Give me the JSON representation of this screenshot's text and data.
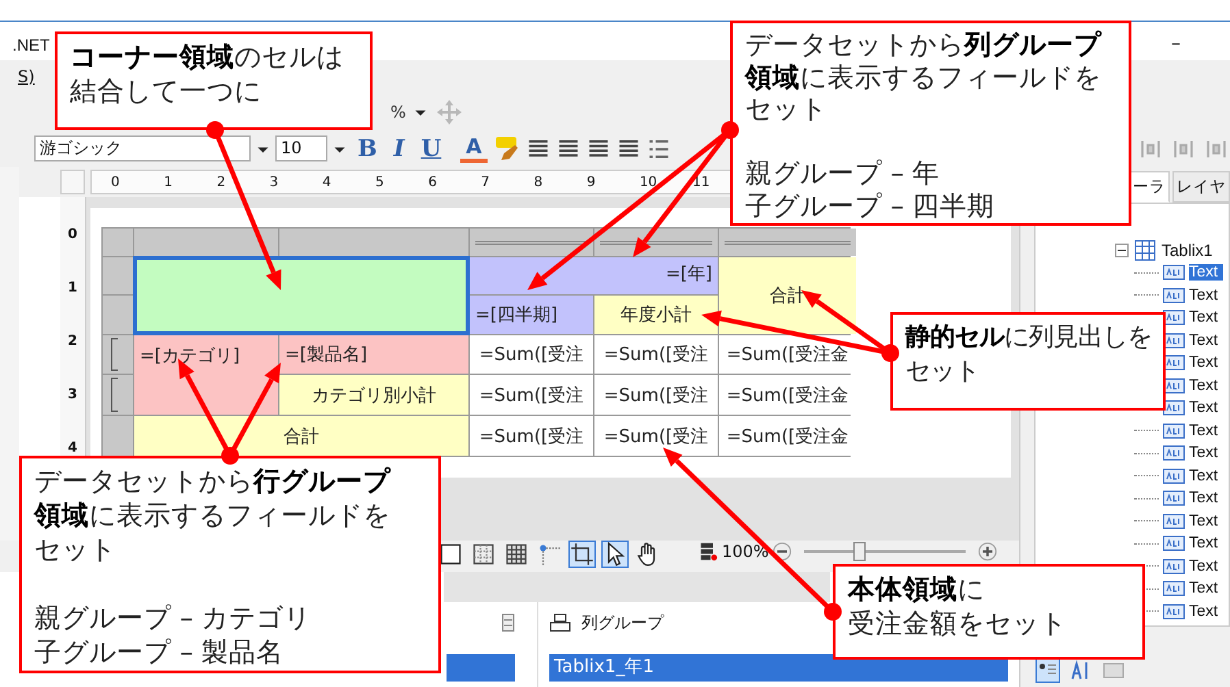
{
  "window": {
    "title": ".NET",
    "minimize": "–"
  },
  "menu": [
    "S)"
  ],
  "toolbar": {
    "zoom_value": "%",
    "font": "游ゴシック",
    "font_size": "10",
    "bold": "B",
    "italic": "I",
    "underline": "U",
    "font_color": "A"
  },
  "ruler": {
    "horizontal": [
      "0",
      "1",
      "2",
      "3",
      "4",
      "5",
      "6",
      "7",
      "8",
      "9",
      "10",
      "11"
    ],
    "vertical": [
      "0",
      "1",
      "2",
      "3",
      "4"
    ]
  },
  "tablix": {
    "cells": [
      {
        "kind": "corner",
        "selected": true
      },
      {
        "kind": "column_group",
        "text": "=[年]",
        "selected": false
      },
      {
        "kind": "static",
        "text": "合計",
        "selected": false
      },
      {
        "kind": "column_group",
        "text": "=[四半期]",
        "selected": false
      },
      {
        "kind": "static",
        "text": "年度小計",
        "selected": false
      },
      {
        "kind": "row_group",
        "text": "=[カテゴリ]",
        "selected": false
      },
      {
        "kind": "row_group",
        "text": "=[製品名]",
        "selected": false
      },
      {
        "kind": "body",
        "text": "=Sum([受注",
        "selected": false
      },
      {
        "kind": "body",
        "text": "=Sum([受注",
        "selected": false
      },
      {
        "kind": "body",
        "text": "=Sum([受注金",
        "selected": false
      },
      {
        "kind": "static",
        "text": "カテゴリ別小計",
        "selected": false
      },
      {
        "kind": "body",
        "text": "=Sum([受注",
        "selected": false
      },
      {
        "kind": "body",
        "text": "=Sum([受注",
        "selected": false
      },
      {
        "kind": "body",
        "text": "=Sum([受注金",
        "selected": false
      },
      {
        "kind": "static",
        "text": "合計",
        "selected": false
      },
      {
        "kind": "body",
        "text": "=Sum([受注",
        "selected": false
      },
      {
        "kind": "body",
        "text": "=Sum([受注",
        "selected": false
      },
      {
        "kind": "body",
        "text": "=Sum([受注金",
        "selected": false
      }
    ]
  },
  "zoom": {
    "reading": "100%",
    "level": 0.34
  },
  "groups": {
    "row_items": [
      {
        "selected": true
      }
    ],
    "column_header": "列グループ",
    "column_items": [
      {
        "label": "Tablix1_年1",
        "selected": true
      }
    ]
  },
  "side_tabs": [
    {
      "label": "ーラ",
      "selected": true
    },
    {
      "label": "レイヤ",
      "selected": false
    }
  ],
  "tree": {
    "label": "Tablix1",
    "expanded": true,
    "children": [
      {
        "label": "Text",
        "selected": true
      },
      {
        "label": "Text",
        "selected": false
      },
      {
        "label": "Text",
        "selected": false
      },
      {
        "label": "Text",
        "selected": false
      },
      {
        "label": "Text",
        "selected": false
      },
      {
        "label": "Text",
        "selected": false
      },
      {
        "label": "Text",
        "selected": false
      },
      {
        "label": "Text",
        "selected": false
      },
      {
        "label": "Text",
        "selected": false
      },
      {
        "label": "Text",
        "selected": false
      },
      {
        "label": "Text",
        "selected": false
      },
      {
        "label": "Text",
        "selected": false
      },
      {
        "label": "Text",
        "selected": false
      },
      {
        "label": "Text",
        "selected": false
      },
      {
        "label": "Text",
        "selected": false
      },
      {
        "label": "Text",
        "selected": false
      }
    ]
  },
  "callouts": [
    {
      "paragraphs": [
        [
          "**コーナー領域**のセルは",
          "結合して一つに"
        ]
      ]
    },
    {
      "paragraphs": [
        [
          "データセットから**列グループ**",
          "**領域**に表示するフィールドを",
          "セット"
        ],
        [
          "親グループ – 年",
          "子グループ – 四半期"
        ]
      ]
    },
    {
      "paragraphs": [
        [
          "**静的セル**に列見出しを",
          "セット"
        ]
      ]
    },
    {
      "paragraphs": [
        [
          "データセットから**行グループ**",
          "**領域**に表示するフィールドを",
          "セット"
        ],
        [
          "親グループ – カテゴリ",
          "子グループ – 製品名"
        ]
      ]
    },
    {
      "paragraphs": [
        [
          "**本体領域**に",
          "受注金額をセット"
        ]
      ]
    }
  ]
}
